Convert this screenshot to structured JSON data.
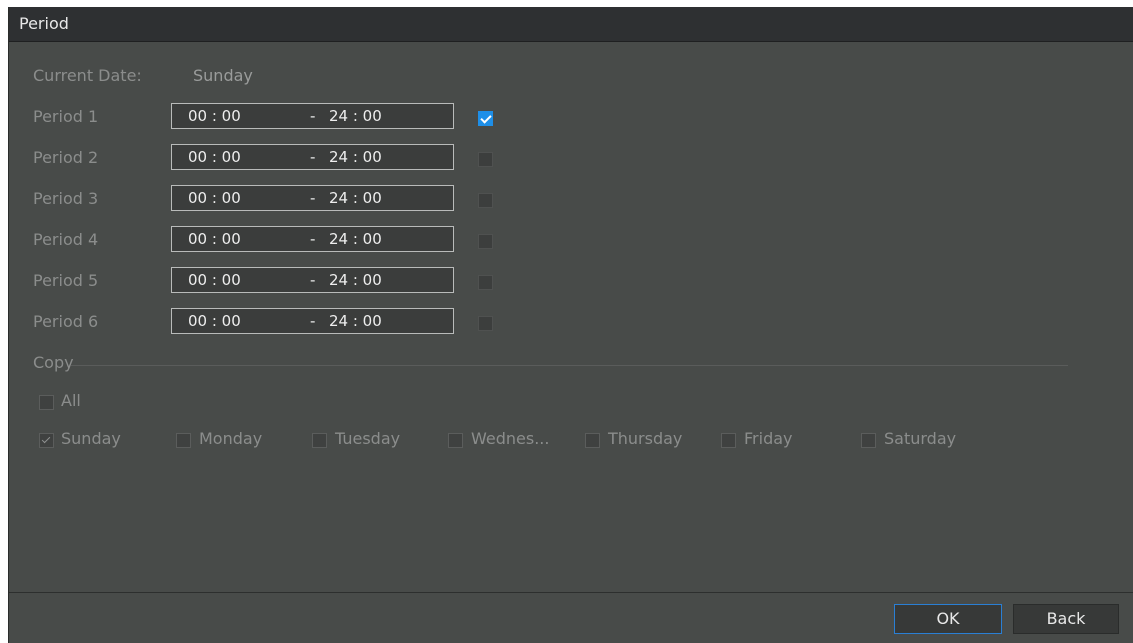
{
  "window": {
    "title": "Period"
  },
  "current_date": {
    "label": "Current Date:",
    "value": "Sunday"
  },
  "periods": [
    {
      "label": "Period 1",
      "start": "00 : 00",
      "dash": "-",
      "end": "24 : 00",
      "enabled": true
    },
    {
      "label": "Period 2",
      "start": "00 : 00",
      "dash": "-",
      "end": "24 : 00",
      "enabled": false
    },
    {
      "label": "Period 3",
      "start": "00 : 00",
      "dash": "-",
      "end": "24 : 00",
      "enabled": false
    },
    {
      "label": "Period 4",
      "start": "00 : 00",
      "dash": "-",
      "end": "24 : 00",
      "enabled": false
    },
    {
      "label": "Period 5",
      "start": "00 : 00",
      "dash": "-",
      "end": "24 : 00",
      "enabled": false
    },
    {
      "label": "Period 6",
      "start": "00 : 00",
      "dash": "-",
      "end": "24 : 00",
      "enabled": false
    }
  ],
  "copy": {
    "label": "Copy",
    "all_label": "All",
    "all_checked": false,
    "days": [
      {
        "label": "Sunday",
        "checked": true
      },
      {
        "label": "Monday",
        "checked": false
      },
      {
        "label": "Tuesday",
        "checked": false
      },
      {
        "label": "Wednes...",
        "checked": false
      },
      {
        "label": "Thursday",
        "checked": false
      },
      {
        "label": "Friday",
        "checked": false
      },
      {
        "label": "Saturday",
        "checked": false
      }
    ]
  },
  "buttons": {
    "ok": "OK",
    "back": "Back"
  },
  "colors": {
    "accent": "#1e8fe8",
    "background": "#484b49",
    "titlebar": "#2e3032"
  }
}
